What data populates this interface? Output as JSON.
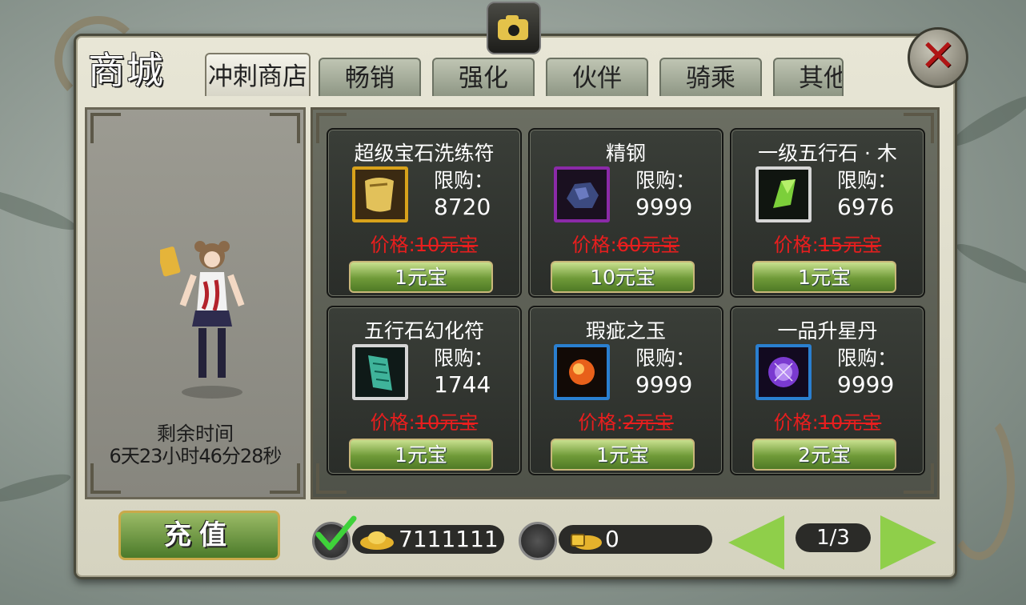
{
  "window": {
    "title": "商城"
  },
  "tabs": [
    "冲刺商店",
    "畅销",
    "强化",
    "伙伴",
    "骑乘",
    "其他"
  ],
  "active_tab": 0,
  "timer": {
    "label": "剩余时间",
    "value": "6天23小时46分28秒"
  },
  "limit_label": "限购：",
  "items": [
    {
      "name": "超级宝石洗练符",
      "limit": "8720",
      "price_prefix": "价格:",
      "old_price": "10元宝",
      "buy_label": "1元宝",
      "icon": "scroll-icon",
      "frame_color": "#d8a21b"
    },
    {
      "name": "精钢",
      "limit": "9999",
      "price_prefix": "价格:",
      "old_price": "60元宝",
      "buy_label": "10元宝",
      "icon": "ore-icon",
      "frame_color": "#8b2aa8"
    },
    {
      "name": "一级五行石 · 木",
      "limit": "6976",
      "price_prefix": "价格:",
      "old_price": "15元宝",
      "buy_label": "1元宝",
      "icon": "green-gem-icon",
      "frame_color": "#d6d6d6"
    },
    {
      "name": "五行石幻化符",
      "limit": "1744",
      "price_prefix": "价格:",
      "old_price": "10元宝",
      "buy_label": "1元宝",
      "icon": "jade-scroll-icon",
      "frame_color": "#d6d6d6"
    },
    {
      "name": "瑕疵之玉",
      "limit": "9999",
      "price_prefix": "价格:",
      "old_price": "2元宝",
      "buy_label": "1元宝",
      "icon": "fire-orb-icon",
      "frame_color": "#2a7fd0"
    },
    {
      "name": "一品升星丹",
      "limit": "9999",
      "price_prefix": "价格:",
      "old_price": "10元宝",
      "buy_label": "2元宝",
      "icon": "purple-orb-icon",
      "frame_color": "#2a7fd0"
    }
  ],
  "footer": {
    "recharge_label": "充值",
    "gold_amount": "7111111",
    "bound_amount": "0",
    "page": "1/3"
  }
}
